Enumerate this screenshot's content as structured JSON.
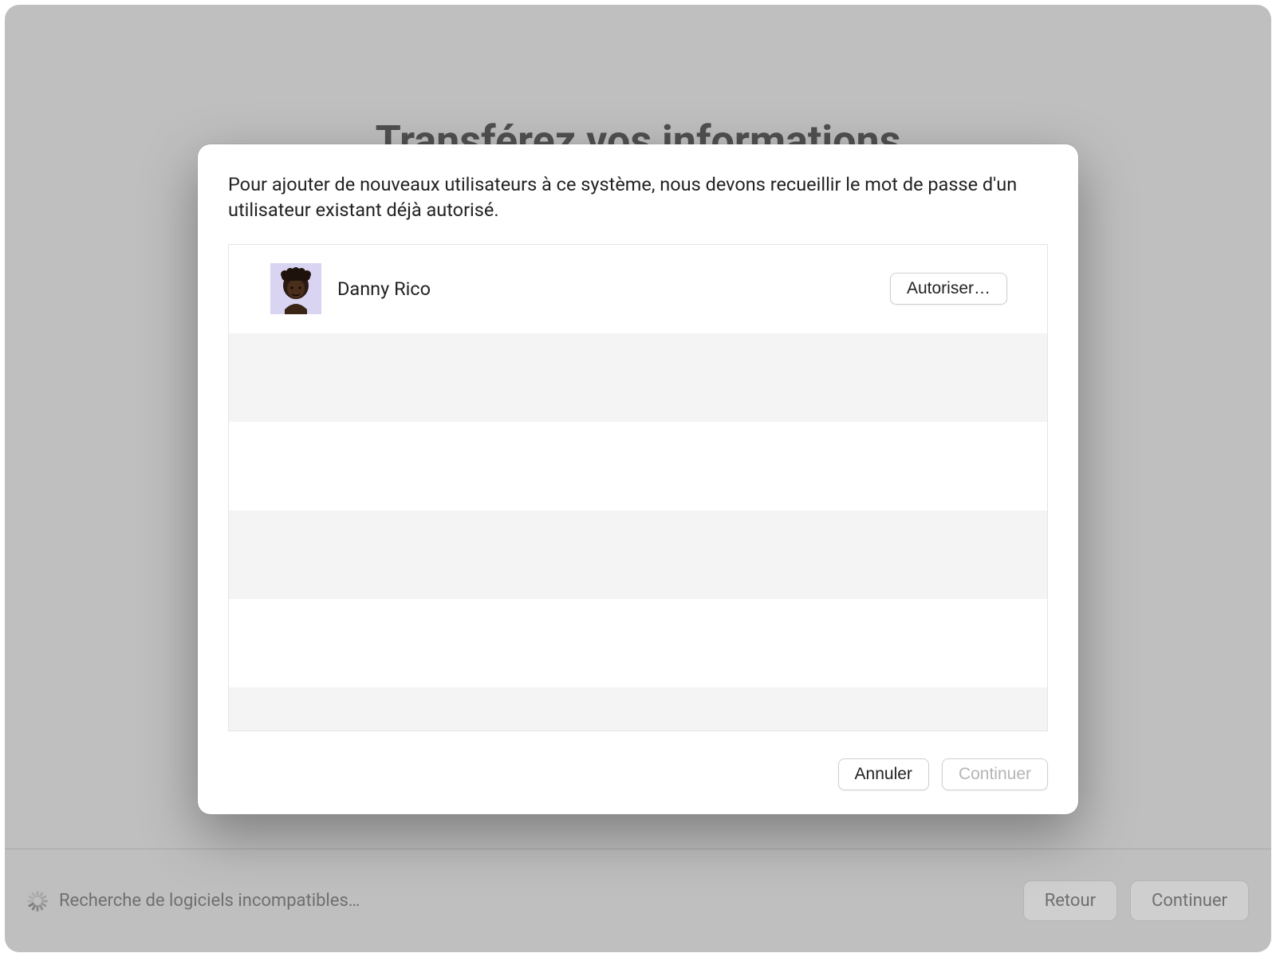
{
  "background": {
    "title": "Transférez vos informations"
  },
  "footer": {
    "status": "Recherche de logiciels incompatibles…",
    "back_label": "Retour",
    "continue_label": "Continuer"
  },
  "modal": {
    "message": "Pour ajouter de nouveaux utilisateurs à ce système, nous devons recueillir le mot de passe d'un utilisateur existant déjà autorisé.",
    "users": [
      {
        "name": "Danny Rico",
        "authorize_label": "Autoriser…"
      }
    ],
    "cancel_label": "Annuler",
    "continue_label": "Continuer"
  }
}
